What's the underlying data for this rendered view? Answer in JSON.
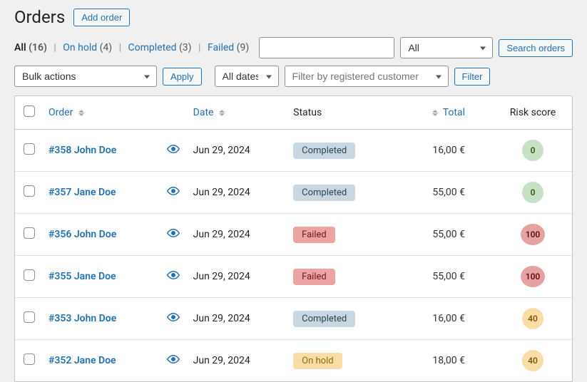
{
  "header": {
    "title": "Orders",
    "add_button": "Add order"
  },
  "status_filters": {
    "all": {
      "label": "All",
      "count": "(16)"
    },
    "onhold": {
      "label": "On hold",
      "count": "(4)"
    },
    "completed": {
      "label": "Completed",
      "count": "(3)"
    },
    "failed": {
      "label": "Failed",
      "count": "(9)"
    }
  },
  "search": {
    "type_filter": "All",
    "button": "Search orders"
  },
  "actions": {
    "bulk": "Bulk actions",
    "apply": "Apply",
    "dates": "All dates",
    "customer_placeholder": "Filter by registered customer",
    "filter": "Filter"
  },
  "columns": {
    "order": "Order",
    "date": "Date",
    "status": "Status",
    "total": "Total",
    "risk": "Risk score"
  },
  "rows": [
    {
      "order": "#358 John Doe",
      "date": "Jun 29, 2024",
      "status": "Completed",
      "status_class": "status-completed",
      "total": "16,00 €",
      "risk": "0",
      "risk_class": "risk-green"
    },
    {
      "order": "#357 Jane Doe",
      "date": "Jun 29, 2024",
      "status": "Completed",
      "status_class": "status-completed",
      "total": "55,00 €",
      "risk": "0",
      "risk_class": "risk-green"
    },
    {
      "order": "#356 John Doe",
      "date": "Jun 29, 2024",
      "status": "Failed",
      "status_class": "status-failed",
      "total": "55,00 €",
      "risk": "100",
      "risk_class": "risk-red"
    },
    {
      "order": "#355 Jane Doe",
      "date": "Jun 29, 2024",
      "status": "Failed",
      "status_class": "status-failed",
      "total": "55,00 €",
      "risk": "100",
      "risk_class": "risk-red"
    },
    {
      "order": "#353 John Doe",
      "date": "Jun 29, 2024",
      "status": "Completed",
      "status_class": "status-completed",
      "total": "16,00 €",
      "risk": "40",
      "risk_class": "risk-yellow"
    },
    {
      "order": "#352 Jane Doe",
      "date": "Jun 29, 2024",
      "status": "On hold",
      "status_class": "status-onhold",
      "total": "18,00 €",
      "risk": "40",
      "risk_class": "risk-yellow"
    }
  ]
}
